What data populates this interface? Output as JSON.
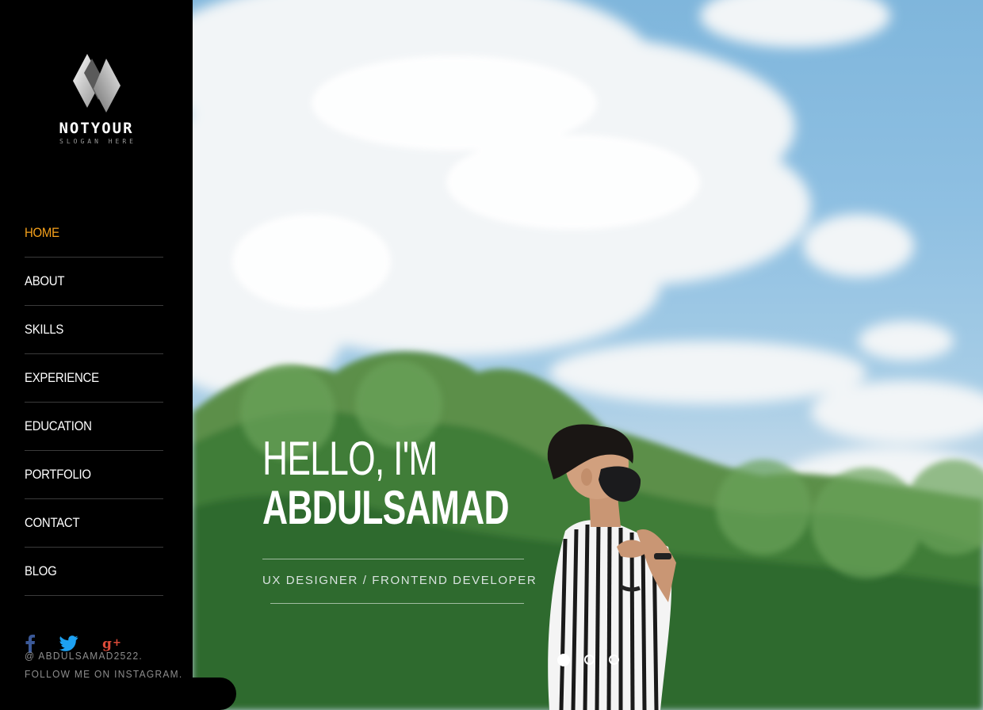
{
  "brand": {
    "name": "NOTYOUR",
    "slogan": "SLOGAN HERE"
  },
  "nav": {
    "items": [
      {
        "label": "HOME",
        "active": true
      },
      {
        "label": "ABOUT"
      },
      {
        "label": "SKILLS"
      },
      {
        "label": "EXPERIENCE"
      },
      {
        "label": "EDUCATION"
      },
      {
        "label": "PORTFOLIO"
      },
      {
        "label": "CONTACT"
      },
      {
        "label": "BLOG"
      }
    ]
  },
  "social": {
    "icons": [
      "facebook-icon",
      "twitter-icon",
      "google-plus-icon"
    ],
    "instagram_line1": "@ ABDULSAMAD2522.",
    "instagram_line2": "FOLLOW ME ON INSTAGRAM."
  },
  "hero": {
    "greeting": "HELLO, I'M",
    "name": "ABDULSAMAD",
    "role": "UX DESIGNER / FRONTEND DEVELOPER",
    "slides_total": 3,
    "active_slide": 1
  },
  "colors": {
    "accent": "#f7a21b",
    "sidebar_bg": "#000000",
    "facebook": "#3b5998",
    "twitter": "#1da1f2",
    "google_plus": "#dd4b39"
  }
}
